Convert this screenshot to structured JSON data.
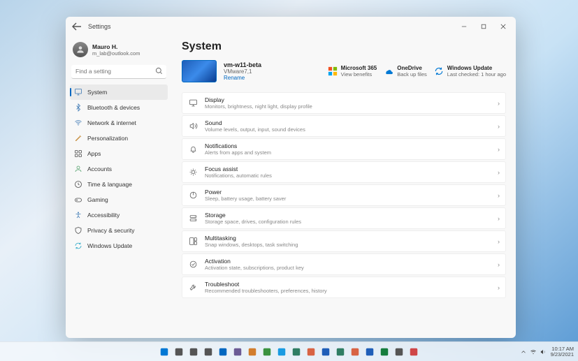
{
  "window": {
    "title": "Settings"
  },
  "user": {
    "name": "Mauro H.",
    "email": "m_lab@outlook.com"
  },
  "search": {
    "placeholder": "Find a setting"
  },
  "sidebar": {
    "items": [
      {
        "icon": "system",
        "label": "System",
        "color": "#3d78b4",
        "active": true
      },
      {
        "icon": "bluetooth",
        "label": "Bluetooth & devices",
        "color": "#3d78b4"
      },
      {
        "icon": "network",
        "label": "Network & internet",
        "color": "#3d78b4"
      },
      {
        "icon": "personalization",
        "label": "Personalization",
        "color": "#c58b3a"
      },
      {
        "icon": "apps",
        "label": "Apps",
        "color": "#4a4a4a"
      },
      {
        "icon": "accounts",
        "label": "Accounts",
        "color": "#56a26d"
      },
      {
        "icon": "time",
        "label": "Time & language",
        "color": "#4a4a4a"
      },
      {
        "icon": "gaming",
        "label": "Gaming",
        "color": "#4a4a4a"
      },
      {
        "icon": "accessibility",
        "label": "Accessibility",
        "color": "#3d78b4"
      },
      {
        "icon": "privacy",
        "label": "Privacy & security",
        "color": "#4a4a4a"
      },
      {
        "icon": "update",
        "label": "Windows Update",
        "color": "#2aa8c7"
      }
    ]
  },
  "page": {
    "title": "System",
    "device": {
      "name": "vm-w11-beta",
      "sub": "VMware7,1",
      "rename": "Rename"
    },
    "tiles": [
      {
        "icon": "m365",
        "title": "Microsoft 365",
        "sub": "View benefits"
      },
      {
        "icon": "onedrive",
        "title": "OneDrive",
        "sub": "Back up files"
      },
      {
        "icon": "winupdate",
        "title": "Windows Update",
        "sub": "Last checked: 1 hour ago"
      }
    ],
    "rows": [
      {
        "icon": "display",
        "title": "Display",
        "sub": "Monitors, brightness, night light, display profile"
      },
      {
        "icon": "sound",
        "title": "Sound",
        "sub": "Volume levels, output, input, sound devices"
      },
      {
        "icon": "notifications",
        "title": "Notifications",
        "sub": "Alerts from apps and system"
      },
      {
        "icon": "focus",
        "title": "Focus assist",
        "sub": "Notifications, automatic rules"
      },
      {
        "icon": "power",
        "title": "Power",
        "sub": "Sleep, battery usage, battery saver"
      },
      {
        "icon": "storage",
        "title": "Storage",
        "sub": "Storage space, drives, configuration rules"
      },
      {
        "icon": "multitask",
        "title": "Multitasking",
        "sub": "Snap windows, desktops, task switching"
      },
      {
        "icon": "activation",
        "title": "Activation",
        "sub": "Activation state, subscriptions, product key"
      },
      {
        "icon": "troubleshoot",
        "title": "Troubleshoot",
        "sub": "Recommended troubleshooters, preferences, history"
      }
    ]
  },
  "taskbar": {
    "time": "10:17 AM",
    "date": "9/23/2021"
  }
}
